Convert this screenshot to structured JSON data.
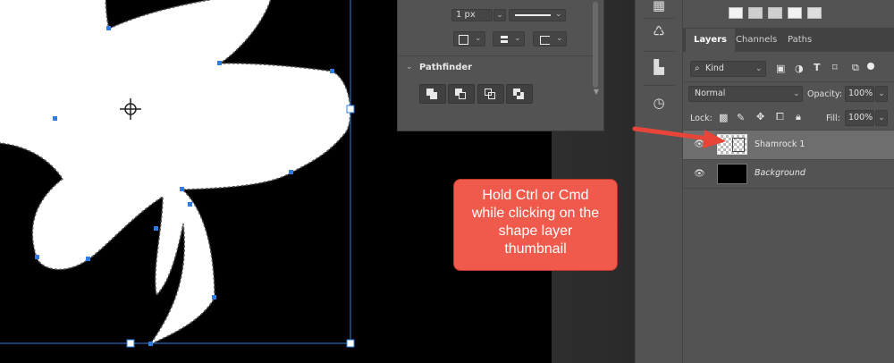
{
  "properties_panel": {
    "stroke_width_value": "1 px",
    "pathfinder_title": "Pathfinder",
    "pathfinder_buttons": [
      "unite-shapes",
      "subtract-front-shape",
      "intersect-shapes",
      "exclude-overlapping-shapes"
    ]
  },
  "side_strip_icons": [
    "adjustments-icon",
    "history-brush-icon",
    "libraries-icon",
    "history-icon"
  ],
  "layers_panel": {
    "tabs": [
      "Layers",
      "Channels",
      "Paths"
    ],
    "active_tab": "Layers",
    "filter_kind": "Kind",
    "blend_mode": "Normal",
    "opacity_label": "Opacity:",
    "opacity_value": "100%",
    "lock_label": "Lock:",
    "fill_label": "Fill:",
    "fill_value": "100%",
    "layers": [
      {
        "name": "Shamrock 1",
        "selected": true
      },
      {
        "name": "Background",
        "selected": false
      }
    ]
  },
  "callout": {
    "lines": [
      "Hold Ctrl or Cmd",
      "while clicking on the",
      "shape layer",
      "thumbnail"
    ],
    "color": "#ef5a4c"
  },
  "colors": {
    "canvas": "#000000",
    "panel": "#535353",
    "selected_layer": "#6e6e6e",
    "path_handle": "#2f7de1"
  }
}
